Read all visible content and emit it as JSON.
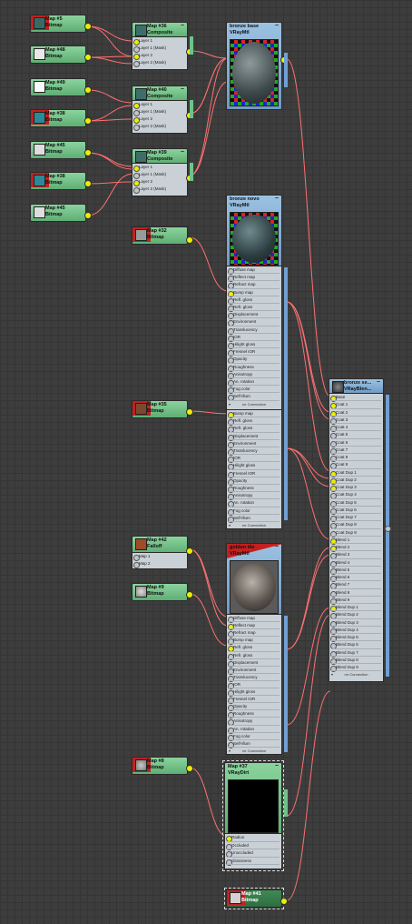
{
  "editor": "Slate Material Editor view",
  "colors": {
    "wire": "#ff7070",
    "socket_on": "#e8f000",
    "socket_off": "#bfc6cc",
    "map_header": "#5fae74",
    "mtl_header": "#6f99c2"
  },
  "bitmaps": [
    {
      "title": "Map #5",
      "type": "Bitmap",
      "marked": true
    },
    {
      "title": "Map #48",
      "type": "Bitmap"
    },
    {
      "title": "Map #49",
      "type": "Bitmap"
    },
    {
      "title": "Map #38",
      "type": "Bitmap",
      "marked": true
    },
    {
      "title": "Map #45",
      "type": "Bitmap"
    },
    {
      "title": "Map #38",
      "type": "Bitmap",
      "marked": true
    },
    {
      "title": "Map #45",
      "type": "Bitmap"
    }
  ],
  "composites": [
    {
      "title": "Map #36",
      "type": "Composite",
      "slots": [
        "Layer 1",
        "Layer 1 (Mask)",
        "Layer 2",
        "Layer 2 (Mask)"
      ]
    },
    {
      "title": "Map #40",
      "type": "Composite",
      "slots": [
        "Layer 1",
        "Layer 1 (Mask)",
        "Layer 2",
        "Layer 2 (Mask)"
      ]
    },
    {
      "title": "Map #39",
      "type": "Composite",
      "slots": [
        "Layer 1",
        "Layer 1 (Mask)",
        "Layer 2",
        "Layer 2 (Mask)"
      ]
    }
  ],
  "bronze_base": {
    "title": "bronze base",
    "type": "VRayMtl"
  },
  "bronze_novo": {
    "title": "bronze novo",
    "type": "VRayMtl",
    "slots": [
      "Diffuse map",
      "Reflect map",
      "Refract map",
      "Bump map",
      "Refl. gloss",
      "Refr. gloss",
      "Displacement",
      "Environment",
      "Translucency",
      "IOR",
      "Hilight gloss",
      "Fresnel IOR",
      "Opacity",
      "Roughness",
      "Anisotropy",
      "An. rotation",
      "Fog color",
      "Self-Illum"
    ],
    "footer": "mr Connection"
  },
  "bronze_ext": {
    "slots": [
      "Bump map",
      "Refl. gloss",
      "Refr. gloss",
      "Displacement",
      "Environment",
      "Translucency",
      "IOR",
      "Hilight gloss",
      "Fresnel IOR",
      "Opacity",
      "Roughness",
      "Anisotropy",
      "An. rotation",
      "Fog color",
      "Self-Illum"
    ],
    "footer": "mr Connection"
  },
  "map_32": {
    "title": "Map #32",
    "type": "Bitmap"
  },
  "map_35": {
    "title": "Map #35",
    "type": "Bitmap"
  },
  "map_42": {
    "title": "Map #42",
    "type": "Falloff",
    "slots": [
      "Map 1",
      "Map 2"
    ]
  },
  "map_9": {
    "title": "Map #9",
    "type": "Bitmap"
  },
  "map_8": {
    "title": "Map #8",
    "type": "Bitmap"
  },
  "map_41": {
    "title": "Map #41",
    "type": "Bitmap"
  },
  "golden": {
    "title": "golden tile",
    "type": "VRayMtl",
    "slots": [
      "Diffuse map",
      "Reflect map",
      "Refract map",
      "Bump map",
      "Refl. gloss",
      "Refr. gloss",
      "Displacement",
      "Environment",
      "Translucency",
      "IOR",
      "Hilight gloss",
      "Fresnel IOR",
      "Opacity",
      "Roughness",
      "Anisotropy",
      "An. rotation",
      "Fog color",
      "Self-Illum"
    ],
    "footer": "mr Connection"
  },
  "dirt": {
    "title": "Map #37",
    "type": "VRayDirt",
    "slots": [
      "Radius",
      "Occluded",
      "Unoccluded",
      "Glossiness"
    ]
  },
  "blend": {
    "title": "bronze se...",
    "type": "VRayBlen...",
    "slots": [
      "Base",
      "Coat 1",
      "Coat 2",
      "Coat 3",
      "Coat 4",
      "Coat 5",
      "Coat 6",
      "Coat 7",
      "Coat 8",
      "Coat 9",
      "Coat Dup 1",
      "Coat Dup 2",
      "Coat Dup 3",
      "Coat Dup 4",
      "Coat Dup 5",
      "Coat Dup 6",
      "Coat Dup 7",
      "Coat Dup 8",
      "Coat Dup 9",
      "Blend 1",
      "Blend 2",
      "Blend 3",
      "Blend 4",
      "Blend 5",
      "Blend 6",
      "Blend 7",
      "Blend 8",
      "Blend 9",
      "Blend Dup 1",
      "Blend Dup 2",
      "Blend Dup 3",
      "Blend Dup 4",
      "Blend Dup 5",
      "Blend Dup 6",
      "Blend Dup 7",
      "Blend Dup 8",
      "Blend Dup 9"
    ],
    "footer": "mr Connection"
  }
}
